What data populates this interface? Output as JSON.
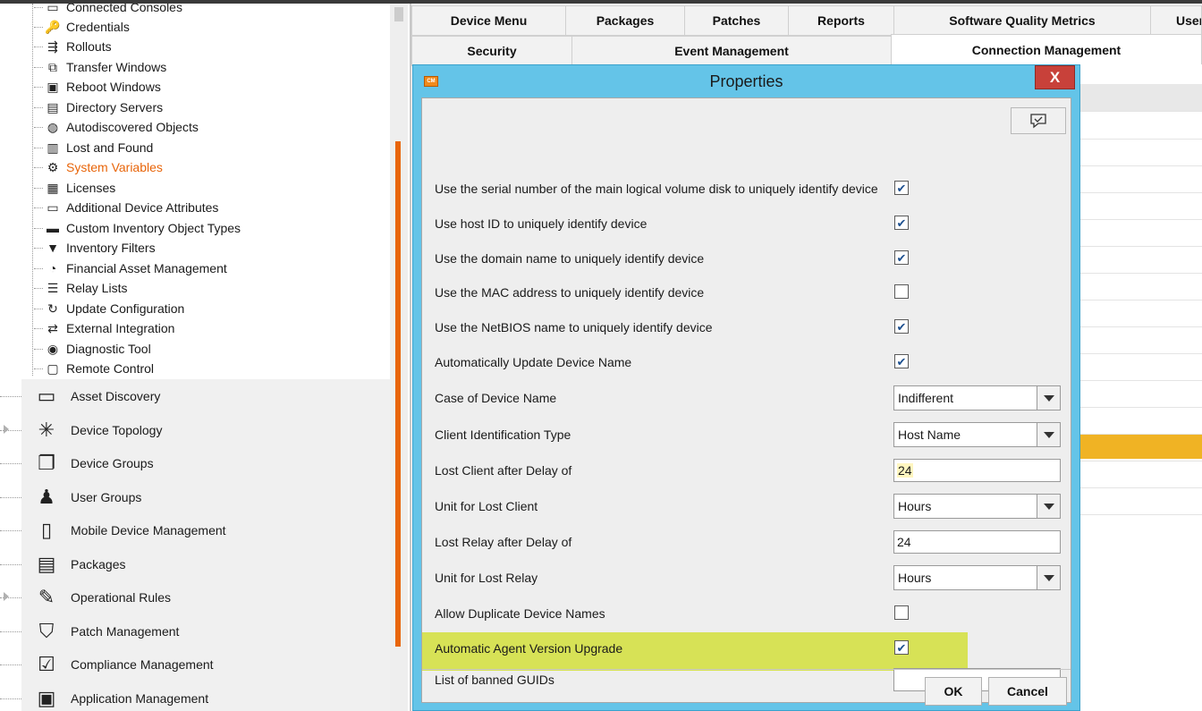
{
  "tree": {
    "items": [
      {
        "label": "Connected Consoles",
        "icon": "console-icon"
      },
      {
        "label": "Credentials",
        "icon": "key-icon"
      },
      {
        "label": "Rollouts",
        "icon": "rollout-icon"
      },
      {
        "label": "Transfer Windows",
        "icon": "transfer-window-icon"
      },
      {
        "label": "Reboot Windows",
        "icon": "reboot-window-icon"
      },
      {
        "label": "Directory Servers",
        "icon": "directory-icon"
      },
      {
        "label": "Autodiscovered Objects",
        "icon": "globe-icon"
      },
      {
        "label": "Lost and Found",
        "icon": "trash-icon"
      },
      {
        "label": "System Variables",
        "icon": "variables-icon",
        "selected": true
      },
      {
        "label": "Licenses",
        "icon": "license-icon"
      },
      {
        "label": "Additional Device Attributes",
        "icon": "monitor-icon"
      },
      {
        "label": "Custom Inventory Object Types",
        "icon": "paint-roller-icon"
      },
      {
        "label": "Inventory Filters",
        "icon": "filter-icon"
      },
      {
        "label": "Financial Asset Management",
        "icon": "finance-icon"
      },
      {
        "label": "Relay Lists",
        "icon": "list-icon"
      },
      {
        "label": "Update Configuration",
        "icon": "refresh-icon"
      },
      {
        "label": "External Integration",
        "icon": "shuffle-icon"
      },
      {
        "label": "Diagnostic Tool",
        "icon": "diagnostic-icon"
      },
      {
        "label": "Remote Control",
        "icon": "remote-control-icon"
      }
    ]
  },
  "modules": [
    {
      "label": "Asset Discovery",
      "icon": "asset-discovery-icon"
    },
    {
      "label": "Device Topology",
      "icon": "topology-icon"
    },
    {
      "label": "Device Groups",
      "icon": "device-groups-icon"
    },
    {
      "label": "User Groups",
      "icon": "user-groups-icon"
    },
    {
      "label": "Mobile Device Management",
      "icon": "mobile-device-icon"
    },
    {
      "label": "Packages",
      "icon": "packages-icon"
    },
    {
      "label": "Operational Rules",
      "icon": "operational-rules-icon"
    },
    {
      "label": "Patch Management",
      "icon": "shield-icon"
    },
    {
      "label": "Compliance Management",
      "icon": "compliance-icon"
    },
    {
      "label": "Application Management",
      "icon": "application-icon"
    }
  ],
  "tabs": {
    "row1": [
      "Device Menu",
      "Packages",
      "Patches",
      "Reports",
      "Software Quality Metrics",
      "User"
    ],
    "row2": [
      "Security",
      "Event Management",
      "Connection Management"
    ],
    "active": "Connection Management"
  },
  "dialog": {
    "title": "Properties",
    "logo_text": "CM",
    "close_label": "X",
    "ok_label": "OK",
    "cancel_label": "Cancel",
    "properties": [
      {
        "label": "Use the serial number of the main logical volume disk to uniquely identify device",
        "type": "checkbox",
        "checked": true
      },
      {
        "label": "Use host ID to uniquely identify device",
        "type": "checkbox",
        "checked": true
      },
      {
        "label": "Use the domain name to uniquely identify device",
        "type": "checkbox",
        "checked": true
      },
      {
        "label": "Use the MAC address to uniquely identify device",
        "type": "checkbox",
        "checked": false
      },
      {
        "label": "Use the NetBIOS name to uniquely identify device",
        "type": "checkbox",
        "checked": true
      },
      {
        "label": "Automatically Update Device Name",
        "type": "checkbox",
        "checked": true
      },
      {
        "label": "Case of Device Name",
        "type": "select",
        "value": "Indifferent"
      },
      {
        "label": "Client Identification Type",
        "type": "select",
        "value": "Host Name"
      },
      {
        "label": "Lost Client after Delay of",
        "type": "text",
        "value": "24"
      },
      {
        "label": "Unit for Lost Client",
        "type": "select",
        "value": "Hours"
      },
      {
        "label": "Lost Relay after Delay of",
        "type": "text",
        "value": "24"
      },
      {
        "label": "Unit for Lost Relay",
        "type": "select",
        "value": "Hours"
      },
      {
        "label": "Allow Duplicate Device Names",
        "type": "checkbox",
        "checked": false
      },
      {
        "label": "Automatic Agent Version Upgrade",
        "type": "checkbox",
        "checked": true,
        "highlighted": true
      },
      {
        "label": "List of banned GUIDs",
        "type": "text",
        "value": ""
      }
    ]
  },
  "colors": {
    "accent_orange": "#e8650a",
    "dialog_frame": "#64c4e8",
    "close_red": "#c8413a",
    "highlight_yellow": "#d7e256",
    "grid_selected": "#f0b324"
  }
}
